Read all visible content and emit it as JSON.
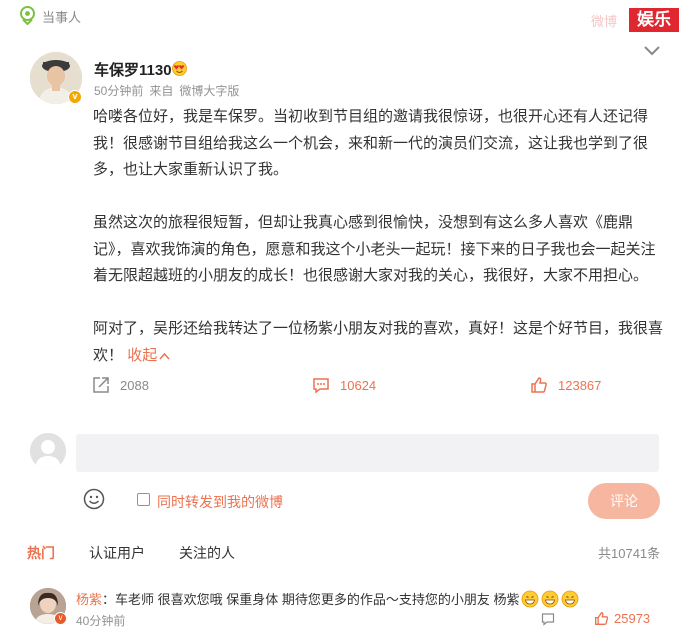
{
  "header": {
    "location_label": "当事人",
    "channel_badge": "娱乐",
    "channel_ghost": "微博"
  },
  "post": {
    "author": "车保罗1130",
    "time": "50分钟前",
    "source_prefix": "来自",
    "source": "微博大字版",
    "paragraphs": [
      "哈喽各位好，我是车保罗。当初收到节目组的邀请我很惊讶，也很开心还有人还记得我！很感谢节目组给我这么一个机会，来和新一代的演员们交流，这让我也学到了很多，也让大家重新认识了我。",
      "虽然这次的旅程很短暂，但却让我真心感到很愉快，没想到有这么多人喜欢《鹿鼎记》，喜欢我饰演的角色，愿意和我这个小老头一起玩！接下来的日子我也会一起关注着无限超越班的小朋友的成长！也很感谢大家对我的关心，我很好，大家不用担心。",
      "阿对了，吴彤还给我转达了一位杨紫小朋友对我的喜欢，真好！这是个好节目，我很喜欢！"
    ],
    "collapse_label": "收起",
    "reposts": "2088",
    "comments": "10624",
    "likes": "123867"
  },
  "compose": {
    "repost_checkbox_label": "同时转发到我的微博",
    "submit_label": "评论"
  },
  "tabs": {
    "items": [
      "热门",
      "认证用户",
      "关注的人"
    ],
    "total": "共10741条"
  },
  "reply": {
    "user": "杨紫",
    "text": "：车老师 很喜欢您哦 保重身体 期待您更多的作品～支持您的小朋友 杨紫",
    "time": "40分钟前",
    "likes": "25973"
  },
  "colors": {
    "accent": "#eb7350",
    "badge_red": "#e0262e",
    "vip_gold": "#f4a800"
  }
}
